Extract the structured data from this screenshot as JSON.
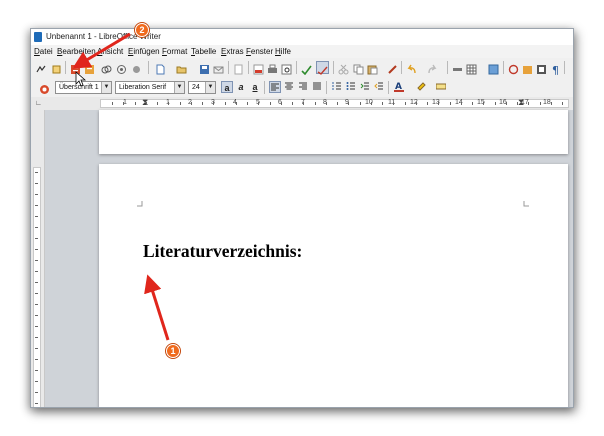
{
  "window": {
    "title": "Unbenannt 1 - LibreOffice Writer"
  },
  "menu": {
    "items": [
      "Datei",
      "Bearbeiten",
      "Ansicht",
      "Einfügen",
      "Format",
      "Tabelle",
      "Extras",
      "Fenster",
      "Hilfe"
    ]
  },
  "formatting": {
    "paragraph_style": "Überschrift 1",
    "font_name": "Liberation Serif",
    "font_size": "24"
  },
  "ruler": {
    "numbers": [
      "1",
      "1",
      "2",
      "3",
      "4",
      "5",
      "6",
      "7",
      "8",
      "9",
      "10",
      "11",
      "12",
      "13",
      "14",
      "15",
      "16",
      "17",
      "18"
    ]
  },
  "document": {
    "heading": "Literaturverzeichnis:"
  },
  "annotations": {
    "badge_1": "1",
    "badge_2": "2",
    "arrow_color": "#e0261c"
  }
}
